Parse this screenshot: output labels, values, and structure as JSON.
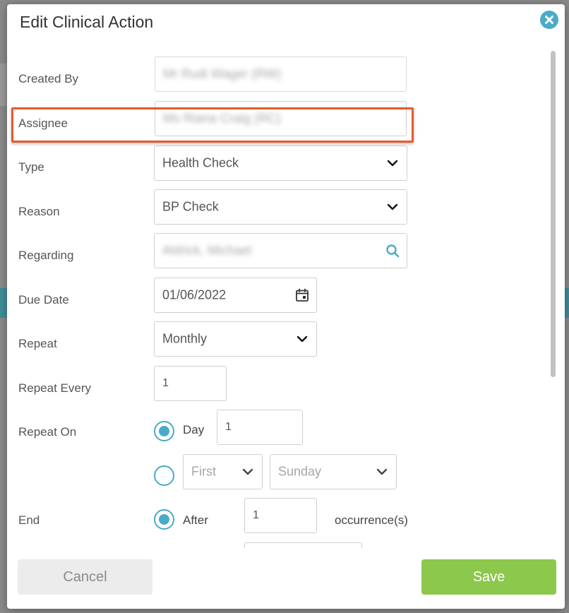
{
  "modal": {
    "title": "Edit Clinical Action",
    "close_icon": "close-icon"
  },
  "form": {
    "created_by": {
      "label": "Created By",
      "value": "Mr Rudi Wager (RW)"
    },
    "assignee": {
      "label": "Assignee",
      "value": "Ms Riana Craig (RC)"
    },
    "type": {
      "label": "Type",
      "value": "Health Check"
    },
    "reason": {
      "label": "Reason",
      "value": "BP Check"
    },
    "regarding": {
      "label": "Regarding",
      "value": "Aldrick, Michael",
      "icon": "search-icon"
    },
    "due_date": {
      "label": "Due Date",
      "value": "01/06/2022",
      "icon": "calendar-icon"
    },
    "repeat": {
      "label": "Repeat",
      "value": "Monthly"
    },
    "repeat_every": {
      "label": "Repeat Every",
      "value": "1"
    },
    "repeat_on": {
      "label": "Repeat On",
      "day_label": "Day",
      "day_value": "1",
      "day_checked": true,
      "ordinal_value": "First",
      "weekday_value": "Sunday",
      "ordinal_checked": false
    },
    "end": {
      "label": "End",
      "after_label": "After",
      "after_value": "1",
      "after_suffix": "occurrence(s)",
      "after_checked": true
    }
  },
  "footer": {
    "cancel_label": "Cancel",
    "save_label": "Save"
  },
  "colors": {
    "accent": "#4aabc7",
    "save": "#8cc84b",
    "highlight": "#e85a2a"
  }
}
